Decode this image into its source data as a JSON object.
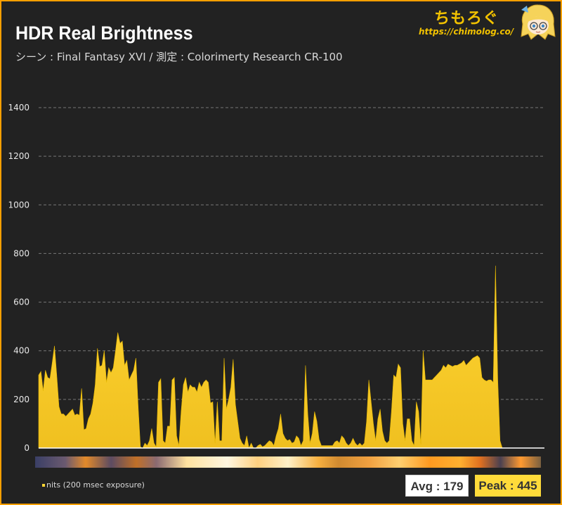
{
  "header": {
    "title": "HDR Real Brightness",
    "subtitle": "シーン : Final Fantasy XVI / 測定 : Colorimerty Research CR-100"
  },
  "logo": {
    "name": "ちもろぐ",
    "url": "https://chimolog.co/"
  },
  "legend": {
    "label": "nits (200 msec exposure)"
  },
  "stats": {
    "avg_label": "Avg : 179",
    "peak_label": "Peak : 445"
  },
  "colors": {
    "background": "#222222",
    "frame": "#ff9f00",
    "fill_top": "#ffd633",
    "fill_bottom": "#f0c020",
    "grid": "#777777"
  },
  "chart_data": {
    "type": "area",
    "title": "HDR Real Brightness",
    "subtitle": "シーン : Final Fantasy XVI / 測定 : Colorimerty Research CR-100",
    "ylabel": "",
    "xlabel": "",
    "ylim": [
      0,
      1400
    ],
    "yticks": [
      0,
      200,
      400,
      600,
      800,
      1000,
      1200,
      1400
    ],
    "grid": true,
    "legend": "bottom-left",
    "series": [
      {
        "name": "nits (200 msec exposure)",
        "values": [
          300,
          315,
          235,
          320,
          290,
          285,
          350,
          420,
          300,
          170,
          140,
          140,
          130,
          140,
          150,
          160,
          135,
          140,
          135,
          245,
          75,
          80,
          120,
          140,
          185,
          260,
          410,
          335,
          340,
          400,
          270,
          330,
          310,
          330,
          400,
          475,
          430,
          440,
          340,
          360,
          280,
          300,
          320,
          370,
          170,
          5,
          0,
          20,
          10,
          30,
          80,
          20,
          5,
          270,
          285,
          30,
          20,
          90,
          90,
          280,
          290,
          50,
          10,
          150,
          260,
          290,
          230,
          260,
          250,
          250,
          230,
          270,
          250,
          270,
          280,
          270,
          185,
          190,
          20,
          190,
          30,
          30,
          370,
          160,
          200,
          250,
          365,
          180,
          110,
          40,
          20,
          10,
          50,
          0,
          20,
          0,
          0,
          10,
          15,
          5,
          10,
          20,
          30,
          25,
          10,
          50,
          80,
          140,
          60,
          40,
          30,
          35,
          20,
          25,
          50,
          40,
          10,
          30,
          340,
          140,
          20,
          60,
          150,
          110,
          35,
          10,
          10,
          10,
          10,
          10,
          10,
          25,
          30,
          20,
          50,
          40,
          20,
          10,
          20,
          40,
          20,
          10,
          20,
          10,
          20,
          110,
          280,
          190,
          100,
          30,
          120,
          160,
          70,
          30,
          20,
          30,
          150,
          300,
          290,
          345,
          330,
          100,
          30,
          120,
          120,
          30,
          10,
          190,
          150,
          15,
          400,
          280,
          280,
          280,
          280,
          290,
          300,
          310,
          320,
          340,
          330,
          345,
          340,
          335,
          340,
          340,
          345,
          350,
          360,
          340,
          350,
          360,
          370,
          375,
          380,
          370,
          290,
          280,
          275,
          280,
          280,
          270,
          750,
          280,
          30,
          0
        ]
      }
    ],
    "avg": 179,
    "peak": 445
  }
}
